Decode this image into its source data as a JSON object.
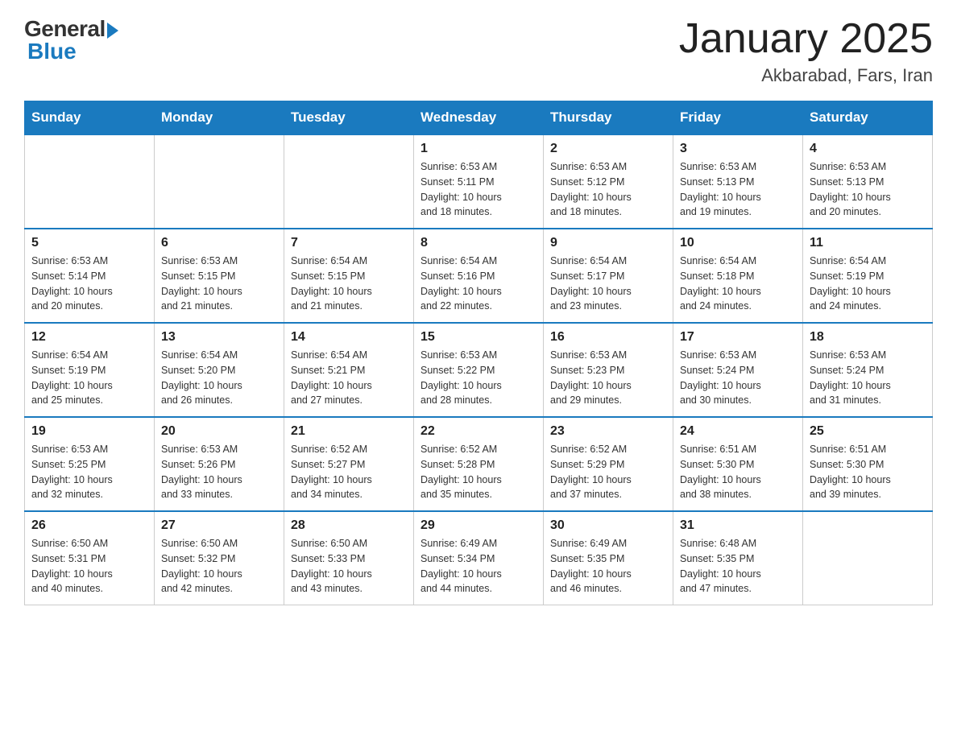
{
  "header": {
    "logo_general": "General",
    "logo_blue": "Blue",
    "title": "January 2025",
    "location": "Akbarabad, Fars, Iran"
  },
  "days_of_week": [
    "Sunday",
    "Monday",
    "Tuesday",
    "Wednesday",
    "Thursday",
    "Friday",
    "Saturday"
  ],
  "weeks": [
    {
      "days": [
        {
          "num": "",
          "info": ""
        },
        {
          "num": "",
          "info": ""
        },
        {
          "num": "",
          "info": ""
        },
        {
          "num": "1",
          "info": "Sunrise: 6:53 AM\nSunset: 5:11 PM\nDaylight: 10 hours\nand 18 minutes."
        },
        {
          "num": "2",
          "info": "Sunrise: 6:53 AM\nSunset: 5:12 PM\nDaylight: 10 hours\nand 18 minutes."
        },
        {
          "num": "3",
          "info": "Sunrise: 6:53 AM\nSunset: 5:13 PM\nDaylight: 10 hours\nand 19 minutes."
        },
        {
          "num": "4",
          "info": "Sunrise: 6:53 AM\nSunset: 5:13 PM\nDaylight: 10 hours\nand 20 minutes."
        }
      ]
    },
    {
      "days": [
        {
          "num": "5",
          "info": "Sunrise: 6:53 AM\nSunset: 5:14 PM\nDaylight: 10 hours\nand 20 minutes."
        },
        {
          "num": "6",
          "info": "Sunrise: 6:53 AM\nSunset: 5:15 PM\nDaylight: 10 hours\nand 21 minutes."
        },
        {
          "num": "7",
          "info": "Sunrise: 6:54 AM\nSunset: 5:15 PM\nDaylight: 10 hours\nand 21 minutes."
        },
        {
          "num": "8",
          "info": "Sunrise: 6:54 AM\nSunset: 5:16 PM\nDaylight: 10 hours\nand 22 minutes."
        },
        {
          "num": "9",
          "info": "Sunrise: 6:54 AM\nSunset: 5:17 PM\nDaylight: 10 hours\nand 23 minutes."
        },
        {
          "num": "10",
          "info": "Sunrise: 6:54 AM\nSunset: 5:18 PM\nDaylight: 10 hours\nand 24 minutes."
        },
        {
          "num": "11",
          "info": "Sunrise: 6:54 AM\nSunset: 5:19 PM\nDaylight: 10 hours\nand 24 minutes."
        }
      ]
    },
    {
      "days": [
        {
          "num": "12",
          "info": "Sunrise: 6:54 AM\nSunset: 5:19 PM\nDaylight: 10 hours\nand 25 minutes."
        },
        {
          "num": "13",
          "info": "Sunrise: 6:54 AM\nSunset: 5:20 PM\nDaylight: 10 hours\nand 26 minutes."
        },
        {
          "num": "14",
          "info": "Sunrise: 6:54 AM\nSunset: 5:21 PM\nDaylight: 10 hours\nand 27 minutes."
        },
        {
          "num": "15",
          "info": "Sunrise: 6:53 AM\nSunset: 5:22 PM\nDaylight: 10 hours\nand 28 minutes."
        },
        {
          "num": "16",
          "info": "Sunrise: 6:53 AM\nSunset: 5:23 PM\nDaylight: 10 hours\nand 29 minutes."
        },
        {
          "num": "17",
          "info": "Sunrise: 6:53 AM\nSunset: 5:24 PM\nDaylight: 10 hours\nand 30 minutes."
        },
        {
          "num": "18",
          "info": "Sunrise: 6:53 AM\nSunset: 5:24 PM\nDaylight: 10 hours\nand 31 minutes."
        }
      ]
    },
    {
      "days": [
        {
          "num": "19",
          "info": "Sunrise: 6:53 AM\nSunset: 5:25 PM\nDaylight: 10 hours\nand 32 minutes."
        },
        {
          "num": "20",
          "info": "Sunrise: 6:53 AM\nSunset: 5:26 PM\nDaylight: 10 hours\nand 33 minutes."
        },
        {
          "num": "21",
          "info": "Sunrise: 6:52 AM\nSunset: 5:27 PM\nDaylight: 10 hours\nand 34 minutes."
        },
        {
          "num": "22",
          "info": "Sunrise: 6:52 AM\nSunset: 5:28 PM\nDaylight: 10 hours\nand 35 minutes."
        },
        {
          "num": "23",
          "info": "Sunrise: 6:52 AM\nSunset: 5:29 PM\nDaylight: 10 hours\nand 37 minutes."
        },
        {
          "num": "24",
          "info": "Sunrise: 6:51 AM\nSunset: 5:30 PM\nDaylight: 10 hours\nand 38 minutes."
        },
        {
          "num": "25",
          "info": "Sunrise: 6:51 AM\nSunset: 5:30 PM\nDaylight: 10 hours\nand 39 minutes."
        }
      ]
    },
    {
      "days": [
        {
          "num": "26",
          "info": "Sunrise: 6:50 AM\nSunset: 5:31 PM\nDaylight: 10 hours\nand 40 minutes."
        },
        {
          "num": "27",
          "info": "Sunrise: 6:50 AM\nSunset: 5:32 PM\nDaylight: 10 hours\nand 42 minutes."
        },
        {
          "num": "28",
          "info": "Sunrise: 6:50 AM\nSunset: 5:33 PM\nDaylight: 10 hours\nand 43 minutes."
        },
        {
          "num": "29",
          "info": "Sunrise: 6:49 AM\nSunset: 5:34 PM\nDaylight: 10 hours\nand 44 minutes."
        },
        {
          "num": "30",
          "info": "Sunrise: 6:49 AM\nSunset: 5:35 PM\nDaylight: 10 hours\nand 46 minutes."
        },
        {
          "num": "31",
          "info": "Sunrise: 6:48 AM\nSunset: 5:35 PM\nDaylight: 10 hours\nand 47 minutes."
        },
        {
          "num": "",
          "info": ""
        }
      ]
    }
  ]
}
